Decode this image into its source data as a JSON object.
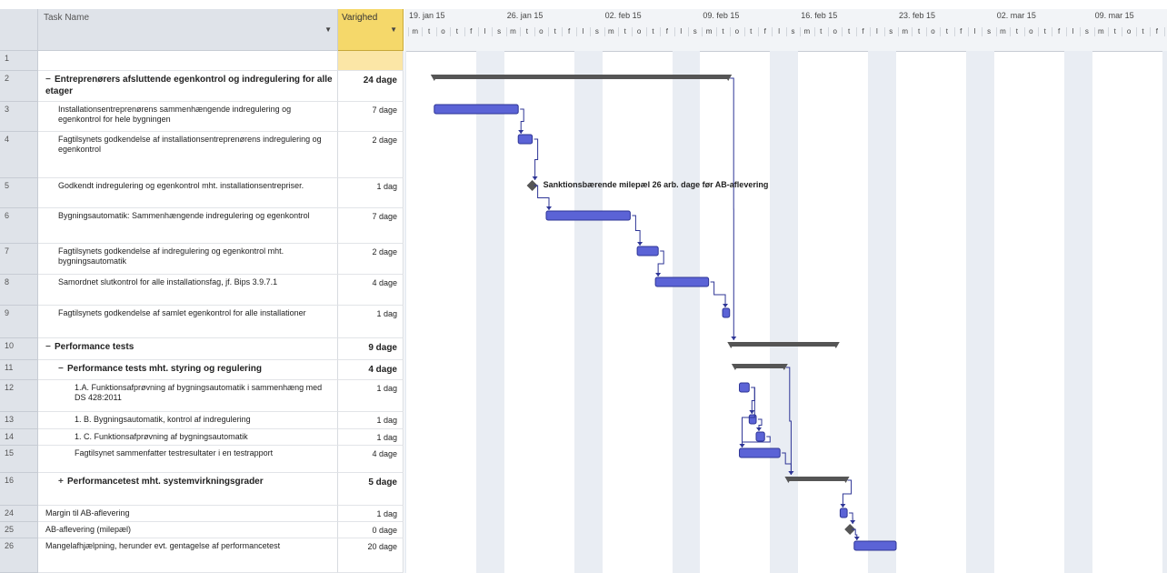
{
  "grid": {
    "header": {
      "task_name": "Task Name",
      "duration": "Varighed"
    },
    "rows": [
      {
        "id": "1",
        "name": "",
        "duration": "",
        "summary": false,
        "level": 0,
        "toggle": ""
      },
      {
        "id": "2",
        "name": "Entreprenørers afsluttende egenkontrol og indregulering for alle etager",
        "duration": "24 dage",
        "summary": true,
        "level": 0,
        "toggle": "−"
      },
      {
        "id": "3",
        "name": "Installationsentreprenørens sammenhængende indregulering og egenkontrol for hele bygningen",
        "duration": "7 dage",
        "summary": false,
        "level": 1,
        "toggle": ""
      },
      {
        "id": "4",
        "name": "Fagtilsynets godkendelse af installationsentreprenørens indregulering og egenkontrol",
        "duration": "2 dage",
        "summary": false,
        "level": 1,
        "toggle": ""
      },
      {
        "id": "5",
        "name": "Godkendt indregulering og egenkontrol mht. installationsentrepriser.",
        "duration": "1 dag",
        "summary": false,
        "level": 1,
        "toggle": ""
      },
      {
        "id": "6",
        "name": "Bygningsautomatik: Sammenhængende indregulering og egenkontrol",
        "duration": "7 dage",
        "summary": false,
        "level": 1,
        "toggle": ""
      },
      {
        "id": "7",
        "name": "Fagtilsynets godkendelse af indregulering og egenkontrol mht. bygningsautomatik",
        "duration": "2 dage",
        "summary": false,
        "level": 1,
        "toggle": ""
      },
      {
        "id": "8",
        "name": "Samordnet slutkontrol for alle installationsfag, jf. Bips 3.9.7.1",
        "duration": "4 dage",
        "summary": false,
        "level": 1,
        "toggle": ""
      },
      {
        "id": "9",
        "name": "Fagtilsynets godkendelse af samlet egenkontrol for alle installationer",
        "duration": "1 dag",
        "summary": false,
        "level": 1,
        "toggle": ""
      },
      {
        "id": "10",
        "name": "Performance tests",
        "duration": "9 dage",
        "summary": true,
        "level": 0,
        "toggle": "−"
      },
      {
        "id": "11",
        "name": "Performance tests mht. styring og regulering",
        "duration": "4 dage",
        "summary": true,
        "level": 1,
        "toggle": "−"
      },
      {
        "id": "12",
        "name": "1.A. Funktionsafprøvning af bygningsautomatik i sammenhæng med DS 428:2011",
        "duration": "1 dag",
        "summary": false,
        "level": 2,
        "toggle": ""
      },
      {
        "id": "13",
        "name": "1. B. Bygningsautomatik, kontrol af indregulering",
        "duration": "1 dag",
        "summary": false,
        "level": 2,
        "toggle": ""
      },
      {
        "id": "14",
        "name": "1. C. Funktionsafprøvning af bygningsautomatik",
        "duration": "1 dag",
        "summary": false,
        "level": 2,
        "toggle": ""
      },
      {
        "id": "15",
        "name": "Fagtilsynet sammenfatter testresultater i en testrapport",
        "duration": "4 dage",
        "summary": false,
        "level": 2,
        "toggle": ""
      },
      {
        "id": "16",
        "name": "Performancetest mht. systemvirkningsgrader",
        "duration": "5 dage",
        "summary": true,
        "level": 1,
        "toggle": "+"
      },
      {
        "id": "24",
        "name": "Margin til AB-aflevering",
        "duration": "1 dag",
        "summary": false,
        "level": 0,
        "toggle": ""
      },
      {
        "id": "25",
        "name": "AB-aflevering (milepæl)",
        "duration": "0 dage",
        "summary": false,
        "level": 0,
        "toggle": ""
      },
      {
        "id": "26",
        "name": "Mangelafhjælpning, herunder evt. gentagelse af performancetest",
        "duration": "20 dage",
        "summary": false,
        "level": 0,
        "toggle": ""
      }
    ]
  },
  "timescale": {
    "weeks": [
      "19. jan 15",
      "26. jan 15",
      "02. feb 15",
      "09. feb 15",
      "16. feb 15",
      "23. feb 15",
      "02. mar 15",
      "09. mar 15"
    ],
    "day_letters": [
      "m",
      "t",
      "o",
      "t",
      "f",
      "l",
      "s"
    ]
  },
  "chart": {
    "milestone_label": "Sanktionsbærende milepæl 26 arb. dage før AB-aflevering",
    "colors": {
      "task": "#5b63d6",
      "task_border": "#2e3596",
      "summary": "#555555",
      "link": "#2e3596",
      "milestone": "#555555"
    }
  }
}
